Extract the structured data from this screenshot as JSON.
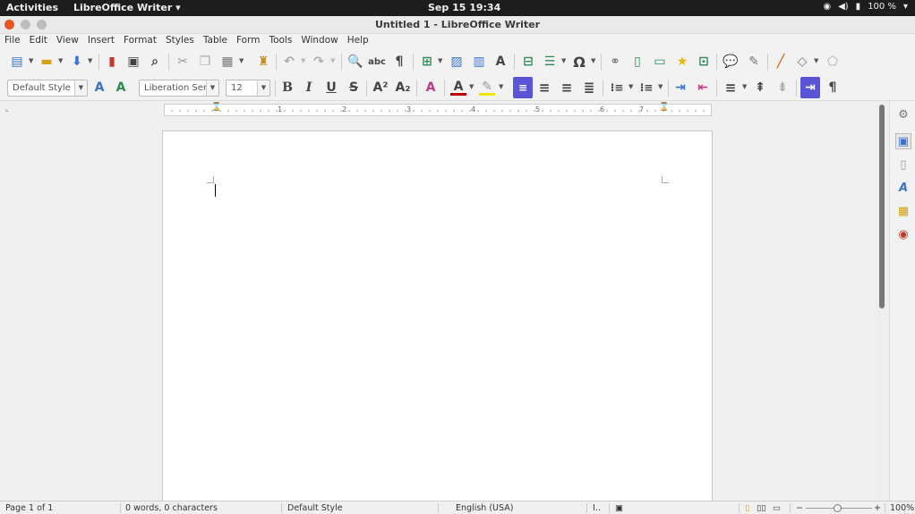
{
  "topbar": {
    "activities": "Activities",
    "app": "LibreOffice Writer ▾",
    "clock": "Sep 15  19:34",
    "battery": "100 %"
  },
  "window": {
    "title": "Untitled 1 - LibreOffice Writer"
  },
  "menu": [
    "File",
    "Edit",
    "View",
    "Insert",
    "Format",
    "Styles",
    "Table",
    "Form",
    "Tools",
    "Window",
    "Help"
  ],
  "format_bar": {
    "paragraph_style": "Default Style",
    "font_name": "Liberation Ser",
    "font_size": "12"
  },
  "ruler": {
    "ticks": [
      "1",
      "2",
      "3",
      "4",
      "5",
      "6",
      "7"
    ]
  },
  "status": {
    "page": "Page 1 of 1",
    "words": "0 words, 0 characters",
    "style": "Default Style",
    "language": "English (USA)",
    "zoom": "100%"
  },
  "colors": {
    "accent": "#5a54d6",
    "font_color": "#c00000",
    "highlight": "#f2e600"
  }
}
